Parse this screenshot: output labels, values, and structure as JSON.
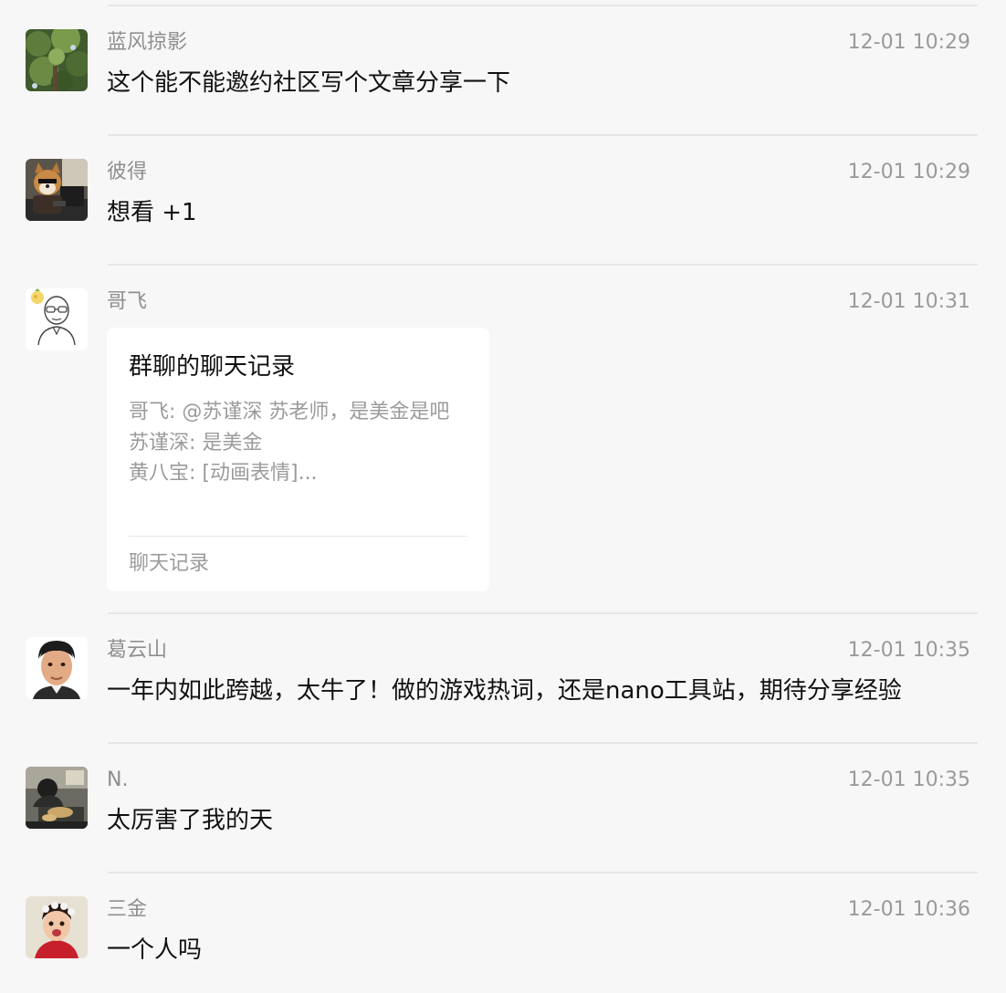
{
  "messages": [
    {
      "name": "蓝风掠影",
      "time": "12-01 10:29",
      "text": "这个能不能邀约社区写个文章分享一下",
      "avatar_icon": "tree-canopy-photo-icon"
    },
    {
      "name": "彼得",
      "time": "12-01 10:29",
      "text": "想看 +1",
      "avatar_icon": "shiba-dog-at-computer-icon"
    },
    {
      "name": "哥飞",
      "time": "12-01 10:31",
      "avatar_icon": "bald-man-with-glasses-sketch-icon",
      "card": {
        "title": "群聊的聊天记录",
        "lines": [
          "哥飞: @苏谨深 苏老师，是美金是吧",
          "苏谨深: 是美金",
          "黄八宝: [动画表情]..."
        ],
        "footer": "聊天记录"
      }
    },
    {
      "name": "葛云山",
      "time": "12-01 10:35",
      "text": "一年内如此跨越，太牛了！做的游戏热词，还是nano工具站，期待分享经验",
      "avatar_icon": "cartoon-man-portrait-icon"
    },
    {
      "name": "N.",
      "time": "12-01 10:35",
      "text": "太厉害了我的天",
      "avatar_icon": "person-at-desk-photo-icon"
    },
    {
      "name": "三金",
      "time": "12-01 10:36",
      "text": "一个人吗",
      "avatar_icon": "child-with-flower-crown-icon"
    }
  ],
  "colors": {
    "background": "#f7f7f7",
    "divider": "#e6e6e6",
    "name": "#8f8f8f",
    "time": "#9a9a9a",
    "text": "#111111",
    "card_bg": "#ffffff"
  }
}
